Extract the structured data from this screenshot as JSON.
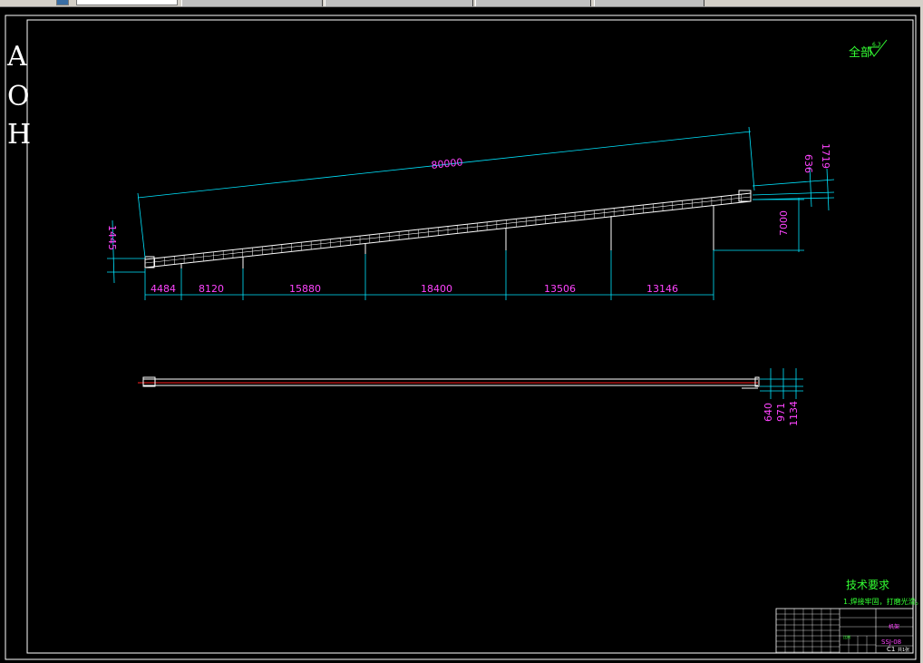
{
  "colors": {
    "background": "#000000",
    "frame": "#ffffff",
    "dimension_line": "#00e5ff",
    "dimension_text": "#ff44ff",
    "annotation_text": "#33ff33",
    "part_line": "#ffffff",
    "center_line": "#ff2020"
  },
  "side_label": {
    "letters": [
      "A",
      "O",
      "H"
    ]
  },
  "roughness": {
    "prefix": "全部",
    "value": "6.3"
  },
  "elevation_view": {
    "overall_length": "80000",
    "left_rise": "1445",
    "right_rise_small": "636",
    "right_rise_large": "1719",
    "height": "7000",
    "spans": [
      "4484",
      "8120",
      "15880",
      "18400",
      "13506",
      "13146"
    ]
  },
  "plan_view": {
    "widths": [
      "640",
      "971",
      "1134"
    ]
  },
  "tech_requirements": {
    "title": "技术要求",
    "item1": "1.焊接牢固，打磨光滑。"
  },
  "title_block": {
    "drawing_no": "SSJ-08",
    "part_name": "机架",
    "scale_label": "比例",
    "sheet": "C1",
    "extra": "共1张"
  }
}
